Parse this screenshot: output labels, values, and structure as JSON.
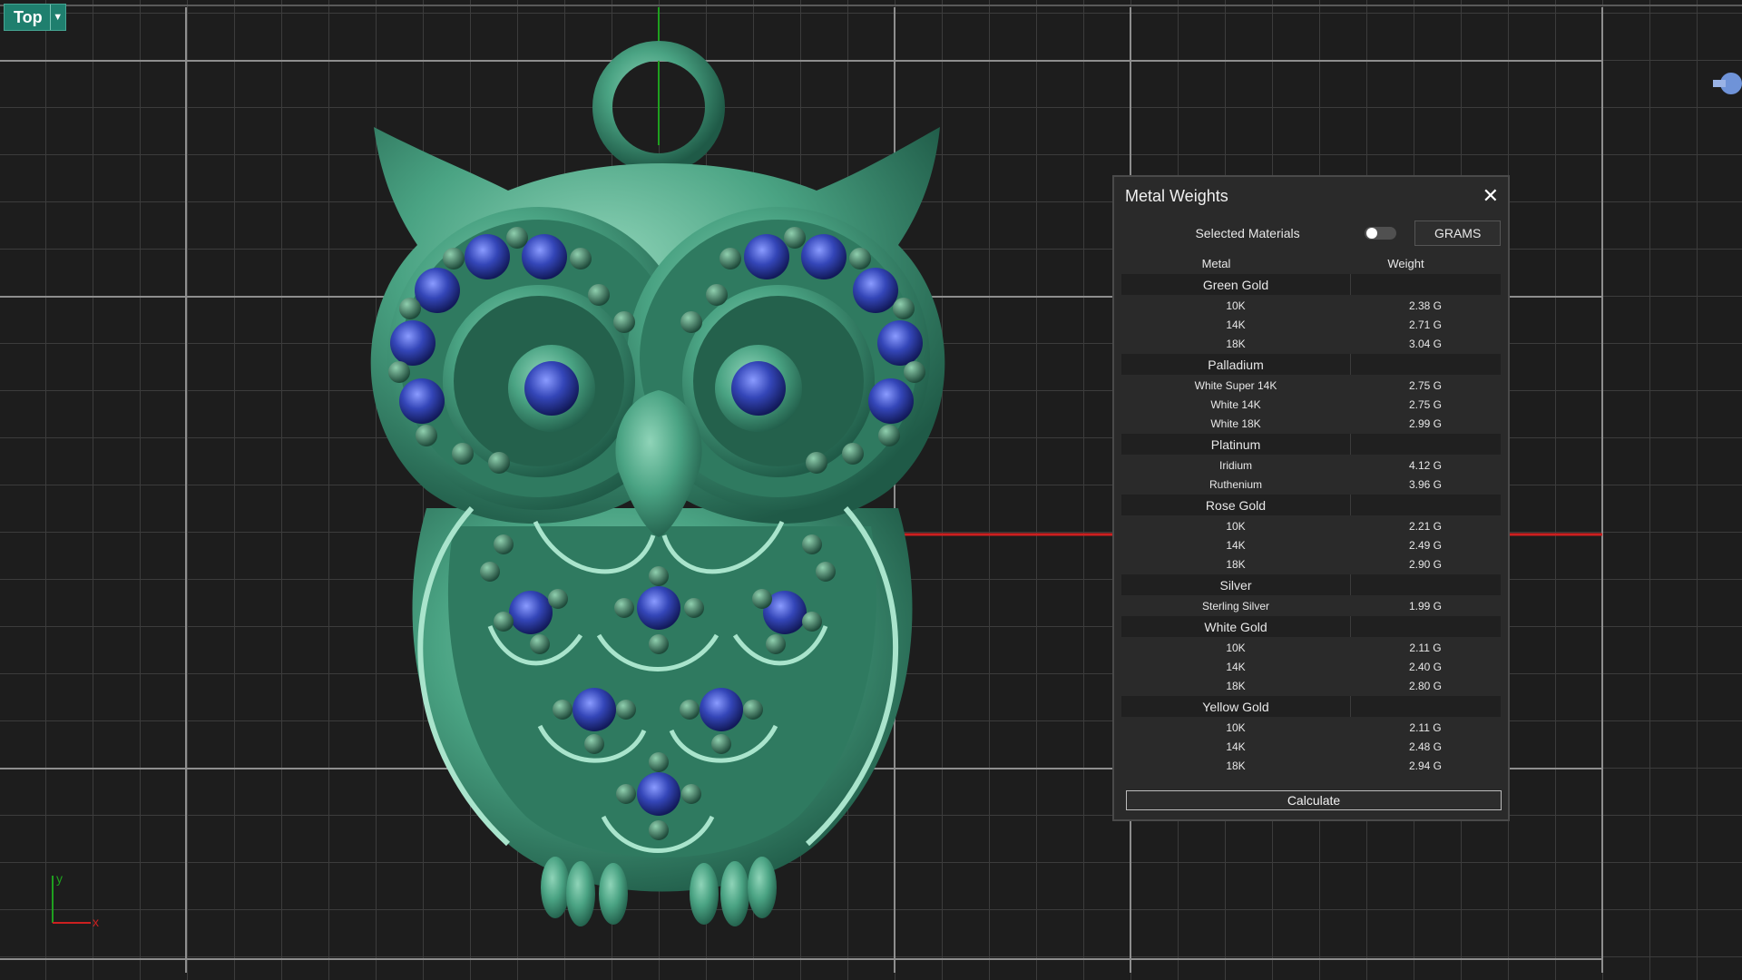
{
  "viewport": {
    "view_name": "Top",
    "axis_x": "x",
    "axis_y": "y"
  },
  "metal_weights": {
    "title": "Metal Weights",
    "selected_materials_label": "Selected Materials",
    "selected_materials_on": false,
    "units_button": "GRAMS",
    "col_metal": "Metal",
    "col_weight": "Weight",
    "groups": [
      {
        "name": "Green Gold",
        "rows": [
          {
            "metal": "10K",
            "weight": "2.38 G"
          },
          {
            "metal": "14K",
            "weight": "2.71 G"
          },
          {
            "metal": "18K",
            "weight": "3.04 G"
          }
        ]
      },
      {
        "name": "Palladium",
        "rows": [
          {
            "metal": "White Super 14K",
            "weight": "2.75 G"
          },
          {
            "metal": "White 14K",
            "weight": "2.75 G"
          },
          {
            "metal": "White 18K",
            "weight": "2.99 G"
          }
        ]
      },
      {
        "name": "Platinum",
        "rows": [
          {
            "metal": "Iridium",
            "weight": "4.12 G"
          },
          {
            "metal": "Ruthenium",
            "weight": "3.96 G"
          }
        ]
      },
      {
        "name": "Rose Gold",
        "rows": [
          {
            "metal": "10K",
            "weight": "2.21 G"
          },
          {
            "metal": "14K",
            "weight": "2.49 G"
          },
          {
            "metal": "18K",
            "weight": "2.90 G"
          }
        ]
      },
      {
        "name": "Silver",
        "rows": [
          {
            "metal": "Sterling Silver",
            "weight": "1.99 G"
          }
        ]
      },
      {
        "name": "White Gold",
        "rows": [
          {
            "metal": "10K",
            "weight": "2.11 G"
          },
          {
            "metal": "14K",
            "weight": "2.40 G"
          },
          {
            "metal": "18K",
            "weight": "2.80 G"
          }
        ]
      },
      {
        "name": "Yellow Gold",
        "rows": [
          {
            "metal": "10K",
            "weight": "2.11 G"
          },
          {
            "metal": "14K",
            "weight": "2.48 G"
          },
          {
            "metal": "18K",
            "weight": "2.94 G"
          }
        ]
      }
    ],
    "calculate_label": "Calculate"
  },
  "colors": {
    "model_green": "#3e9a7a",
    "gem_blue": "#2f3fa8",
    "x_axis": "#cc2020",
    "y_axis": "#1fa01f",
    "view_tab": "#1f7f6e"
  }
}
